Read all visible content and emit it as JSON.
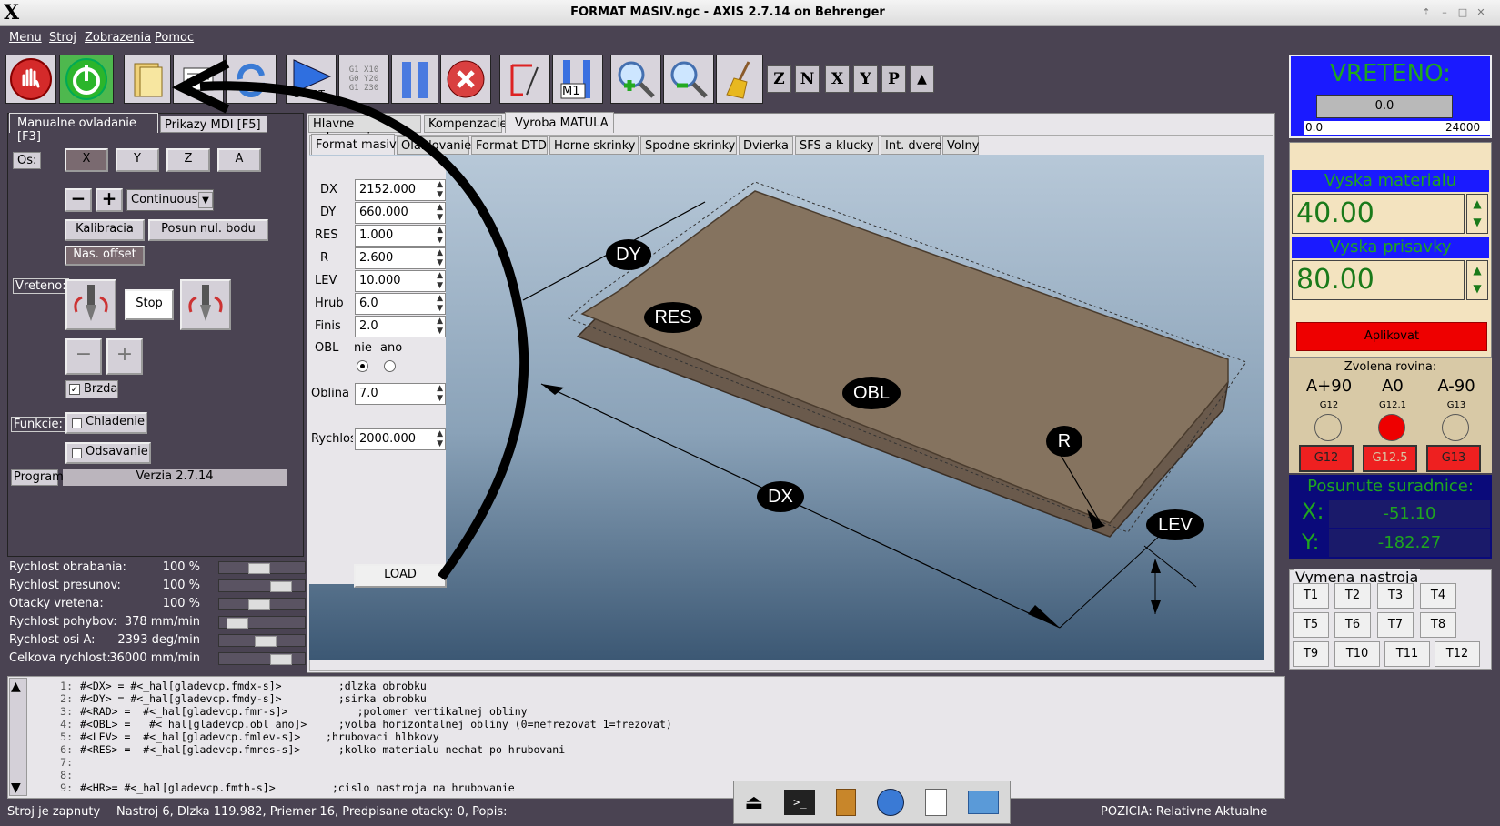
{
  "window": {
    "title": "FORMAT MASIV.ngc - AXIS 2.7.14 on Behrenger",
    "logo": "X"
  },
  "menu": [
    "Menu",
    "Stroj",
    "Zobrazenia",
    "Pomoc"
  ],
  "toolbar": {
    "start_label": "START",
    "m1_label": "M1",
    "gcode_lines": [
      "G1 X10",
      "G0 Y20",
      "G1 Z30"
    ],
    "axis_views": [
      "Z",
      "N",
      "X",
      "Y",
      "P"
    ]
  },
  "left_tabs": [
    "Manualne ovladanie [F3]",
    "Prikazy MDI [F5]"
  ],
  "manual": {
    "os_label": "Os:",
    "axes": [
      "X",
      "Y",
      "Z",
      "A"
    ],
    "minus": "−",
    "plus": "+",
    "mode": "Continuous",
    "kalibracia": "Kalibracia",
    "posun": "Posun nul. bodu",
    "nas_offset": "Nas. offset",
    "vreteno_label": "Vreteno:",
    "stop": "Stop",
    "brzda": "Brzda",
    "funkcie_label": "Funkcie:",
    "chladenie": "Chladenie",
    "odsavanie": "Odsavanie",
    "program_label": "Program",
    "program_value": "Verzia 2.7.14"
  },
  "sliders": [
    {
      "label": "Rychlost obrabania:",
      "value": "100 %",
      "pos": 0.45
    },
    {
      "label": "Rychlost presunov:",
      "value": "100 %",
      "pos": 0.8
    },
    {
      "label": "Otacky vretena:",
      "value": "100 %",
      "pos": 0.45
    },
    {
      "label": "Rychlost pohybov:",
      "value": "378 mm/min",
      "pos": 0.12
    },
    {
      "label": "Rychlost osi A:",
      "value": "2393 deg/min",
      "pos": 0.55
    },
    {
      "label": "Celkova rychlost:",
      "value": "36000 mm/min",
      "pos": 0.8
    }
  ],
  "main_tabs": [
    "Hlavne zobrazenie",
    "Kompenzacie",
    "Vyroba MATULA"
  ],
  "sub_tabs": [
    "Format masiv",
    "Olablovanie",
    "Format DTD",
    "Horne skrinky",
    "Spodne skrinky",
    "Dvierka",
    "SFS a klucky",
    "Int. dvere",
    "Volny"
  ],
  "form": {
    "fields": [
      {
        "label": "DX",
        "value": "2152.000"
      },
      {
        "label": "DY",
        "value": "660.000"
      },
      {
        "label": "RES",
        "value": "1.000"
      },
      {
        "label": "R",
        "value": "2.600"
      },
      {
        "label": "LEV",
        "value": "10.000"
      },
      {
        "label": "Hrub",
        "value": "6.0"
      },
      {
        "label": "Finis",
        "value": "2.0"
      }
    ],
    "obl_label": "OBL",
    "obl_options": [
      "nie",
      "ano"
    ],
    "obl_selected": "nie",
    "oblina_label": "Oblina",
    "oblina_value": "7.0",
    "rychlos_label": "Rychlos",
    "rychlos_value": "2000.000",
    "load": "LOAD"
  },
  "diagram_labels": {
    "dy": "DY",
    "res": "RES",
    "obl": "OBL",
    "dx": "DX",
    "r": "R",
    "lev": "LEV"
  },
  "right": {
    "vreteno_title": "VRETENO:",
    "vreteno_value": "0.0",
    "vreteno_min": "0.0",
    "vreteno_max": "24000",
    "vyska_materialu_title": "Vyska materialu",
    "vyska_materialu": "40.00",
    "vyska_prisavky_title": "Vyska prisavky",
    "vyska_prisavky": "80.00",
    "aplikovat": "Aplikovat",
    "rovina_title": "Zvolena rovina:",
    "planes": [
      {
        "name": "A+90",
        "code": "G12",
        "btn": "G12"
      },
      {
        "name": "A0",
        "code": "G12.1",
        "btn": "G12.5"
      },
      {
        "name": "A-90",
        "code": "G13",
        "btn": "G13"
      }
    ],
    "posunute_title": "Posunute suradnice:",
    "x_label": "X:",
    "x_value": "-51.10",
    "y_label": "Y:",
    "y_value": "-182.27",
    "vymena_title": "Vymena nastroja",
    "tools": [
      "T1",
      "T2",
      "T3",
      "T4",
      "T5",
      "T6",
      "T7",
      "T8",
      "T9",
      "T10",
      "T11",
      "T12"
    ]
  },
  "code_lines": [
    {
      "n": "1:",
      "t": "#<DX> = #<_hal[gladevcp.fmdx-s]>         ;dlzka obrobku"
    },
    {
      "n": "2:",
      "t": "#<DY> = #<_hal[gladevcp.fmdy-s]>         ;sirka obrobku"
    },
    {
      "n": "3:",
      "t": "#<RAD> =  #<_hal[gladevcp.fmr-s]>           ;polomer vertikalnej obliny"
    },
    {
      "n": "4:",
      "t": "#<OBL> =   #<_hal[gladevcp.obl_ano]>     ;volba horizontalnej obliny (0=nefrezovat 1=frezovat)"
    },
    {
      "n": "5:",
      "t": "#<LEV> =  #<_hal[gladevcp.fmlev-s]>    ;hrubovaci hlbkovy"
    },
    {
      "n": "6:",
      "t": "#<RES> =  #<_hal[gladevcp.fmres-s]>      ;kolko materialu nechat po hrubovani"
    },
    {
      "n": "7:",
      "t": ""
    },
    {
      "n": "8:",
      "t": ""
    },
    {
      "n": "9:",
      "t": "#<HR>= #<_hal[gladevcp.fmth-s]>         ;cislo nastroja na hrubovanie"
    }
  ],
  "status": {
    "left": "Stroj je zapnuty",
    "middle": "Nastroj 6, Dlzka 119.982, Priemer 16, Predpisane otacky: 0, Popis:",
    "right": "POZICIA: Relativne Aktualne"
  },
  "colors": {
    "bg": "#4a4352",
    "estop": "#d42a2a",
    "power": "#2bb52b",
    "vreteno_bg": "#1a1aff",
    "beige": "#f3e3bf",
    "aplikovat": "#ee0000",
    "coords_bg": "#0a0a7a",
    "coords_text": "#1fa51f"
  }
}
